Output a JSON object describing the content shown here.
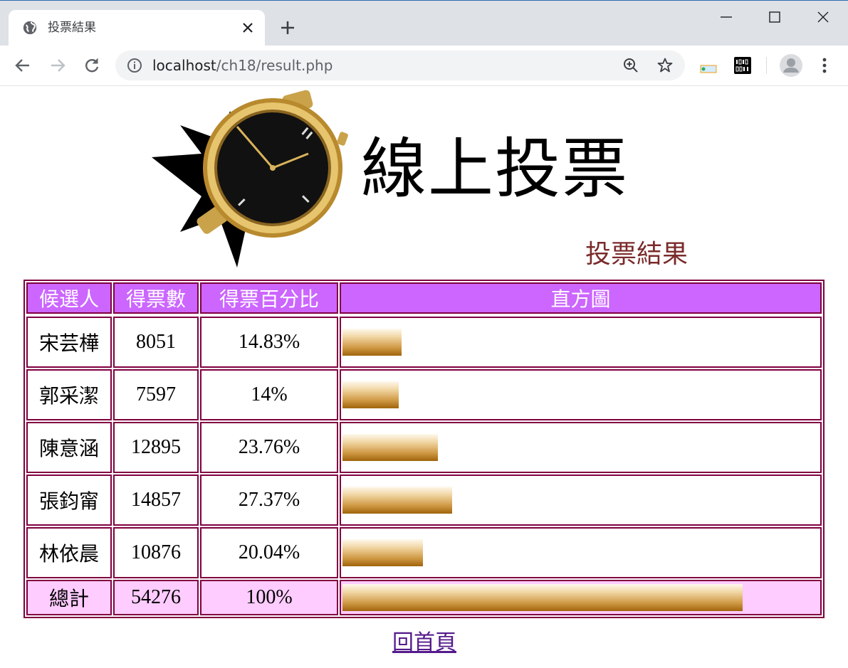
{
  "browser": {
    "tab_title": "投票結果",
    "url_host": "localhost",
    "url_path": "/ch18/result.php",
    "ext_smart_pki": "Smart PKI",
    "ext_binary": "0101 0011"
  },
  "banner": {
    "title": "線上投票",
    "subtitle": "投票結果"
  },
  "table": {
    "headers": [
      "候選人",
      "得票數",
      "得票百分比",
      "直方圖"
    ],
    "rows": [
      {
        "name": "宋芸樺",
        "votes": "8051",
        "percent": "14.83%",
        "bar_fraction": 0.1483
      },
      {
        "name": "郭采潔",
        "votes": "7597",
        "percent": "14%",
        "bar_fraction": 0.14
      },
      {
        "name": "陳意涵",
        "votes": "12895",
        "percent": "23.76%",
        "bar_fraction": 0.2376
      },
      {
        "name": "張鈞甯",
        "votes": "14857",
        "percent": "27.37%",
        "bar_fraction": 0.2737
      },
      {
        "name": "林依晨",
        "votes": "10876",
        "percent": "20.04%",
        "bar_fraction": 0.2004
      }
    ],
    "total": {
      "name": "總計",
      "votes": "54276",
      "percent": "100%",
      "bar_fraction": 1.0
    }
  },
  "colors": {
    "header_bg": "#cc66ff",
    "total_bg": "#ffccff",
    "border": "#800040"
  },
  "footer": {
    "home_link": "回首頁"
  }
}
